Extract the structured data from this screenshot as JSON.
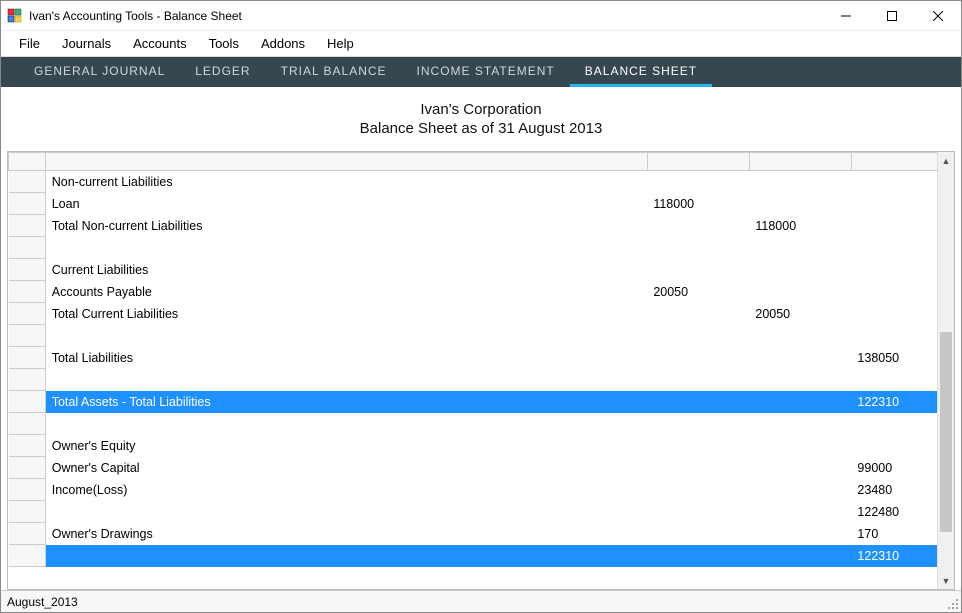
{
  "window": {
    "title": "Ivan's Accounting Tools - Balance Sheet"
  },
  "menu": {
    "file": "File",
    "journals": "Journals",
    "accounts": "Accounts",
    "tools": "Tools",
    "addons": "Addons",
    "help": "Help"
  },
  "tabs": {
    "general_journal": "GENERAL JOURNAL",
    "ledger": "LEDGER",
    "trial_balance": "TRIAL BALANCE",
    "income_statement": "INCOME STATEMENT",
    "balance_sheet": "BALANCE SHEET"
  },
  "report": {
    "company": "Ivan's Corporation",
    "subtitle": "Balance Sheet as of 31 August 2013"
  },
  "rows": [
    {
      "label": "Non-current Liabilities",
      "col2": "",
      "col3": "",
      "col4": ""
    },
    {
      "label": "Loan",
      "col2": "118000",
      "col3": "",
      "col4": ""
    },
    {
      "label": "Total Non-current Liabilities",
      "col2": "",
      "col3": "118000",
      "col4": ""
    },
    {
      "label": "",
      "col2": "",
      "col3": "",
      "col4": ""
    },
    {
      "label": "Current Liabilities",
      "col2": "",
      "col3": "",
      "col4": ""
    },
    {
      "label": "Accounts Payable",
      "col2": "20050",
      "col3": "",
      "col4": ""
    },
    {
      "label": "Total Current Liabilities",
      "col2": "",
      "col3": "20050",
      "col4": ""
    },
    {
      "label": "",
      "col2": "",
      "col3": "",
      "col4": ""
    },
    {
      "label": "Total Liabilities",
      "col2": "",
      "col3": "",
      "col4": "138050"
    },
    {
      "label": "",
      "col2": "",
      "col3": "",
      "col4": ""
    },
    {
      "label": "Total Assets - Total Liabilities",
      "col2": "",
      "col3": "",
      "col4": "122310",
      "highlight": true
    },
    {
      "label": "",
      "col2": "",
      "col3": "",
      "col4": ""
    },
    {
      "label": "Owner's Equity",
      "col2": "",
      "col3": "",
      "col4": ""
    },
    {
      "label": "Owner's Capital",
      "col2": "",
      "col3": "",
      "col4": "99000"
    },
    {
      "label": "Income(Loss)",
      "col2": "",
      "col3": "",
      "col4": "23480"
    },
    {
      "label": "",
      "col2": "",
      "col3": "",
      "col4": "122480"
    },
    {
      "label": "Owner's Drawings",
      "col2": "",
      "col3": "",
      "col4": "170"
    },
    {
      "label": "",
      "col2": "",
      "col3": "",
      "col4": "122310",
      "highlight": true
    }
  ],
  "status": {
    "text": "August_2013"
  }
}
